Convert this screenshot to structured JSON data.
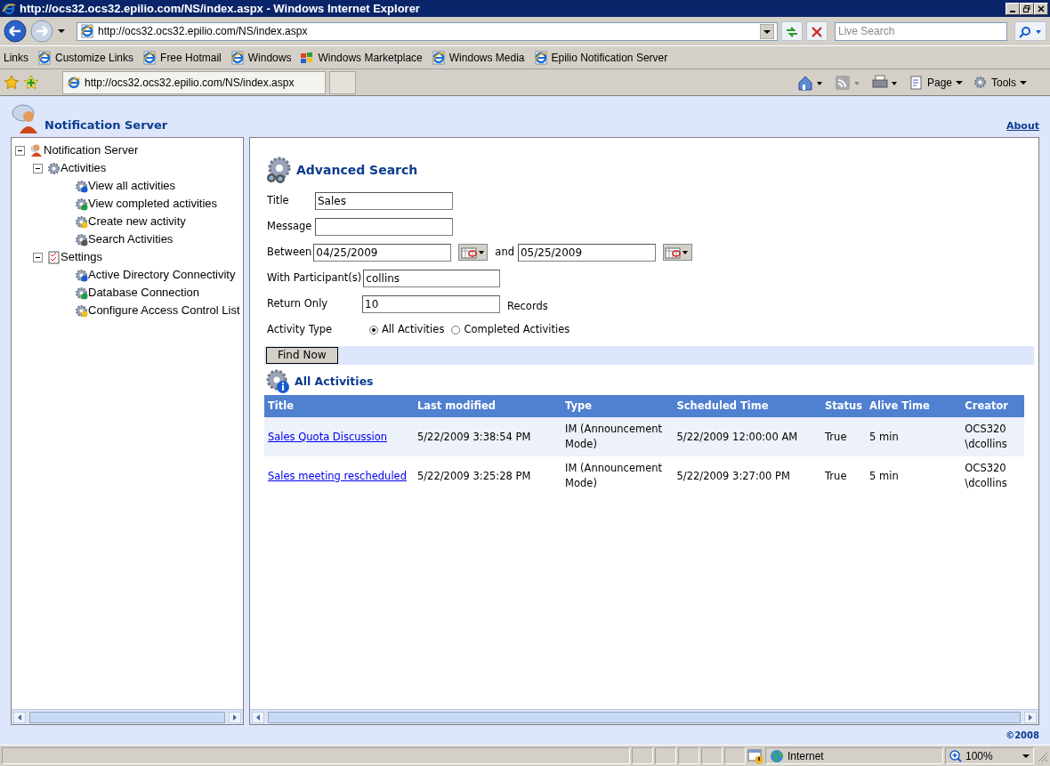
{
  "window": {
    "title": "http://ocs32.ocs32.epilio.com/NS/index.aspx - Windows Internet Explorer"
  },
  "address_bar": {
    "value": "http://ocs32.ocs32.epilio.com/NS/index.aspx",
    "search_placeholder": "Live Search"
  },
  "links_bar": {
    "label": "Links",
    "items": [
      "Customize Links",
      "Free Hotmail",
      "Windows",
      "Windows Marketplace",
      "Windows Media",
      "Epilio Notification Server"
    ]
  },
  "tab": {
    "label": "http://ocs32.ocs32.epilio.com/NS/index.aspx"
  },
  "command_bar": {
    "items": [
      "Page",
      "Tools"
    ]
  },
  "app": {
    "title": "Notification Server",
    "about_link": "About",
    "footer": "©2008"
  },
  "tree": [
    {
      "label": "Notification Server",
      "expanded": true,
      "children": [
        {
          "label": "Activities",
          "expanded": true,
          "children": [
            {
              "label": "View all activities"
            },
            {
              "label": "View completed activities"
            },
            {
              "label": "Create new activity"
            },
            {
              "label": "Search Activities"
            }
          ]
        },
        {
          "label": "Settings",
          "expanded": true,
          "children": [
            {
              "label": "Active Directory Connectivity"
            },
            {
              "label": "Database Connection"
            },
            {
              "label": "Configure Access Control List"
            }
          ]
        }
      ]
    }
  ],
  "search": {
    "heading": "Advanced Search",
    "fields": [
      {
        "kind": "text",
        "label": "Title",
        "value": "Sales"
      },
      {
        "kind": "text",
        "label": "Message"
      },
      {
        "kind": "date-range",
        "label": "Between",
        "from": "04/25/2009",
        "joiner": "and",
        "to": "05/25/2009"
      },
      {
        "kind": "text",
        "label": "With Participant(s)",
        "value": "collins"
      },
      {
        "kind": "text",
        "label": "Return Only",
        "value": "10",
        "suffix": "Records"
      },
      {
        "kind": "radio",
        "label": "Activity Type",
        "options": [
          {
            "label": "All Activities",
            "selected": true
          },
          {
            "label": "Completed Activities",
            "selected": false
          }
        ]
      }
    ],
    "button": "Find Now"
  },
  "results": {
    "heading": "All Activities",
    "columns": [
      "Title",
      "Last modified",
      "Type",
      "Scheduled Time",
      "Status",
      "Alive Time",
      "Creator"
    ],
    "rows": [
      [
        "Sales Quota Discussion",
        "5/22/2009 3:38:54 PM",
        "IM (Announcement Mode)",
        "5/22/2009 12:00:00 AM",
        "True",
        "5 min",
        "OCS320 \\dcollins"
      ],
      [
        "Sales meeting rescheduled",
        "5/22/2009 3:25:28 PM",
        "IM (Announcement Mode)",
        "5/22/2009 3:27:00 PM",
        "True",
        "5 min",
        "OCS320 \\dcollins"
      ]
    ]
  },
  "status_bar": {
    "zone": "Internet",
    "zoom": "100%"
  }
}
